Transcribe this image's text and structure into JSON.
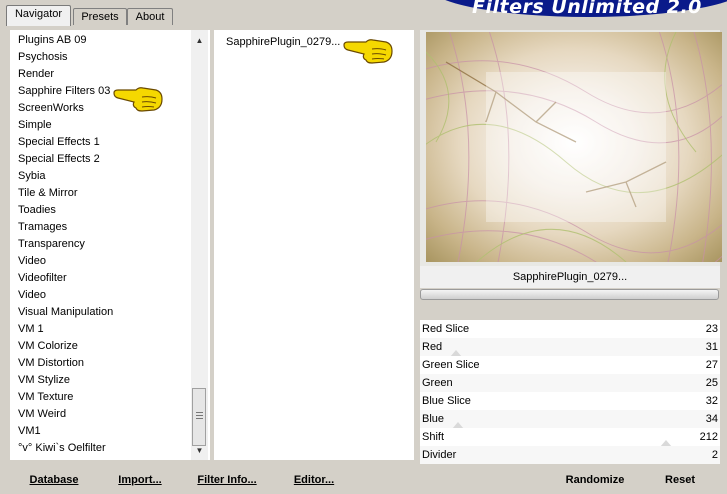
{
  "tabs": [
    {
      "label": "Navigator",
      "active": true
    },
    {
      "label": "Presets",
      "active": false
    },
    {
      "label": "About",
      "active": false
    }
  ],
  "banner": {
    "title": "Filters Unlimited 2.0"
  },
  "categories": [
    "Plugins AB 09",
    "Psychosis",
    "Render",
    "Sapphire Filters 03",
    "ScreenWorks",
    "Simple",
    "Special Effects 1",
    "Special Effects 2",
    "Sybia",
    "Tile & Mirror",
    "Toadies",
    "Tramages",
    "Transparency",
    "Video",
    "Videofilter",
    "Video",
    "Visual Manipulation",
    "VM 1",
    "VM Colorize",
    "VM Distortion",
    "VM Stylize",
    "VM Texture",
    "VM Weird",
    "VM1",
    "°v° Kiwi`s Oelfilter"
  ],
  "selected_category": "Sapphire Filters 03",
  "filters": [
    "SapphirePlugin_0279..."
  ],
  "preview": {
    "filter_name": "SapphirePlugin_0279..."
  },
  "params": [
    {
      "label": "Red Slice",
      "value": "23"
    },
    {
      "label": "Red",
      "value": "31"
    },
    {
      "label": "Green Slice",
      "value": "27"
    },
    {
      "label": "Green",
      "value": "25"
    },
    {
      "label": "Blue Slice",
      "value": "32"
    },
    {
      "label": "Blue",
      "value": "34"
    },
    {
      "label": "Shift",
      "value": "212"
    },
    {
      "label": "Divider",
      "value": "2"
    }
  ],
  "buttons": {
    "database": "Database",
    "import": "Import...",
    "filter_info": "Filter Info...",
    "editor": "Editor...",
    "randomize": "Randomize",
    "reset": "Reset"
  },
  "icons": {
    "pointer": "pointing-hand-icon"
  },
  "colors": {
    "banner": "#0a1a8a",
    "hand": "#f5d800"
  }
}
